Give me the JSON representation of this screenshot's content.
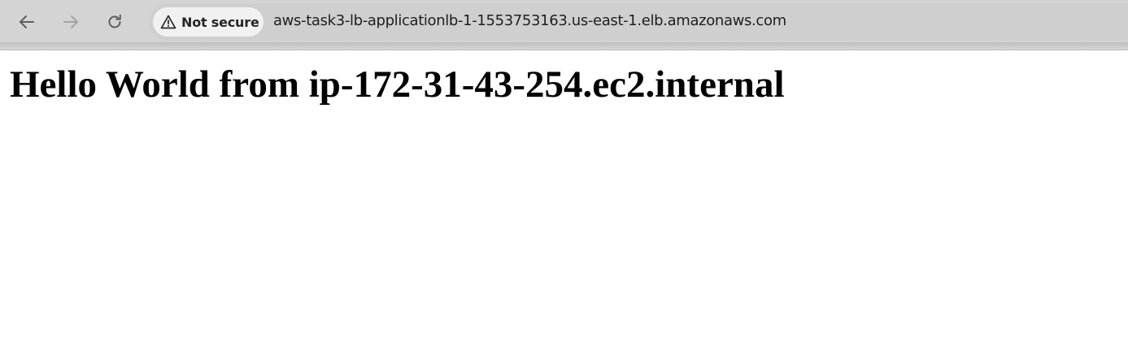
{
  "browser": {
    "security_label": "Not secure",
    "url": "aws-task3-lb-applicationlb-1-1553753163.us-east-1.elb.amazonaws.com",
    "icons": {
      "back": "arrow-left-icon",
      "forward": "arrow-right-icon",
      "reload": "reload-icon",
      "security": "warning-triangle-icon"
    }
  },
  "page": {
    "heading": "Hello World from ip-172-31-43-254.ec2.internal"
  }
}
